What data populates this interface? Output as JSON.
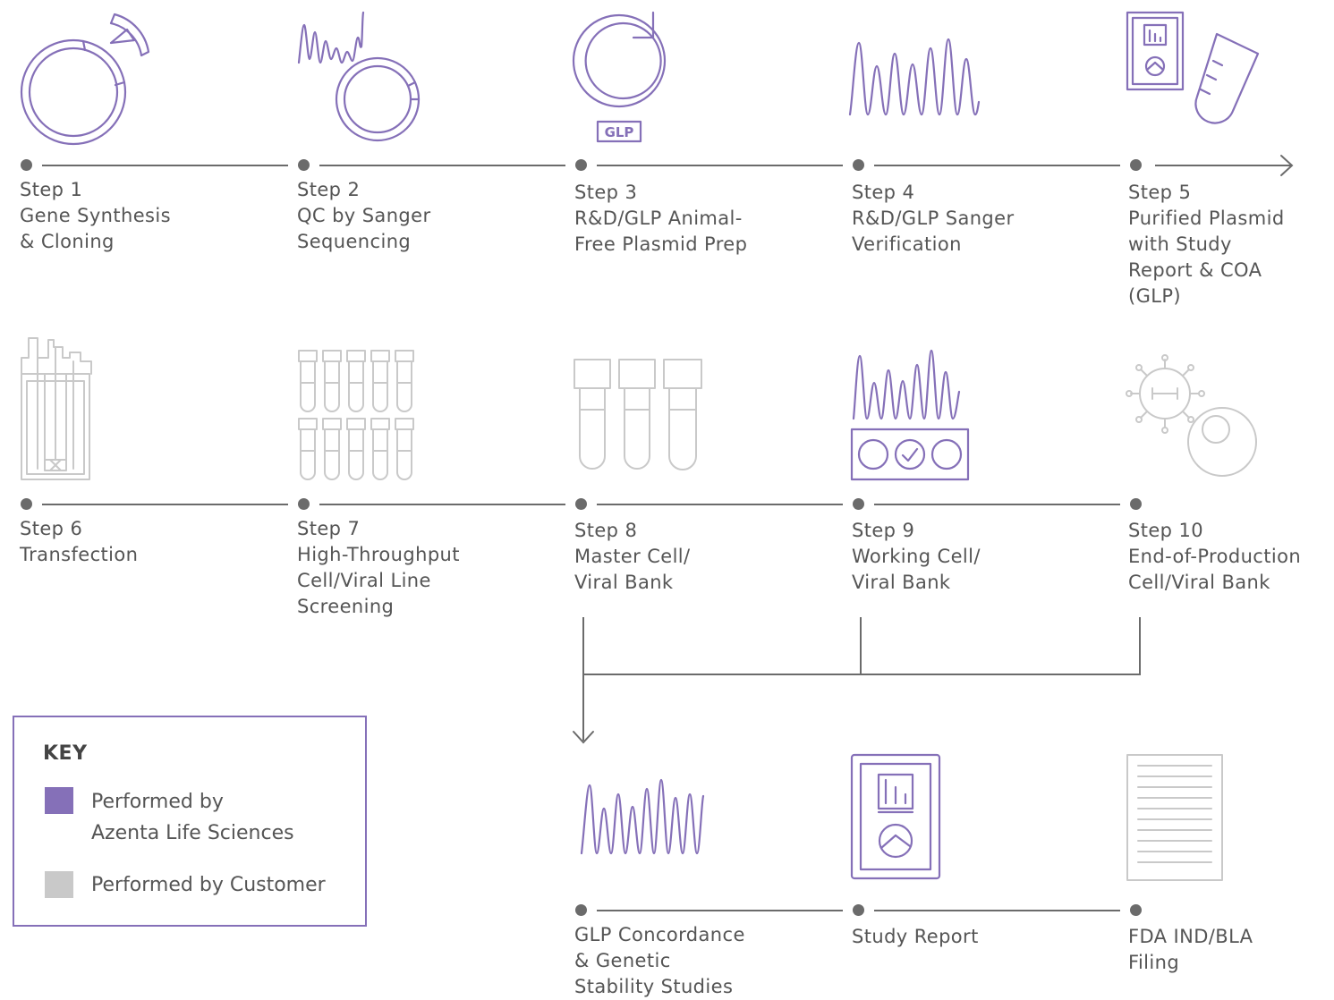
{
  "steps": [
    {
      "number": "Step 1",
      "lines": [
        "Gene Synthesis",
        "& Cloning"
      ]
    },
    {
      "number": "Step 2",
      "lines": [
        "QC by Sanger",
        "Sequencing"
      ]
    },
    {
      "number": "Step 3",
      "lines": [
        "R&D/GLP Animal-",
        "Free Plasmid Prep"
      ]
    },
    {
      "number": "Step 4",
      "lines": [
        "R&D/GLP Sanger",
        "Verification"
      ]
    },
    {
      "number": "Step 5",
      "lines": [
        "Purified Plasmid",
        "with Study",
        "Report & COA",
        "(GLP)"
      ]
    },
    {
      "number": "Step 6",
      "lines": [
        "Transfection"
      ]
    },
    {
      "number": "Step 7",
      "lines": [
        "High-Throughput",
        "Cell/Viral Line",
        "Screening"
      ]
    },
    {
      "number": "Step 8",
      "lines": [
        "Master Cell/",
        "Viral Bank"
      ]
    },
    {
      "number": "Step 9",
      "lines": [
        "Working Cell/",
        "Viral Bank"
      ]
    },
    {
      "number": "Step 10",
      "lines": [
        "End-of-Production",
        "Cell/Viral Bank"
      ]
    }
  ],
  "outcomes": [
    {
      "lines": [
        "GLP Concordance",
        "& Genetic",
        "Stability Studies"
      ]
    },
    {
      "lines": [
        "Study Report"
      ]
    },
    {
      "lines": [
        "FDA IND/BLA",
        "Filing"
      ]
    }
  ],
  "glp_badge": "GLP",
  "key": {
    "title": "KEY",
    "items": [
      {
        "lines": [
          "Performed by",
          "Azenta Life Sciences"
        ],
        "color": "#8570b8"
      },
      {
        "lines": [
          "Performed by Customer"
        ],
        "color": "#c9c9c9"
      }
    ]
  },
  "colors": {
    "azenta": "#8570b8",
    "customer": "#c9c9c9",
    "line": "#6b6b6b",
    "text": "#555555"
  }
}
